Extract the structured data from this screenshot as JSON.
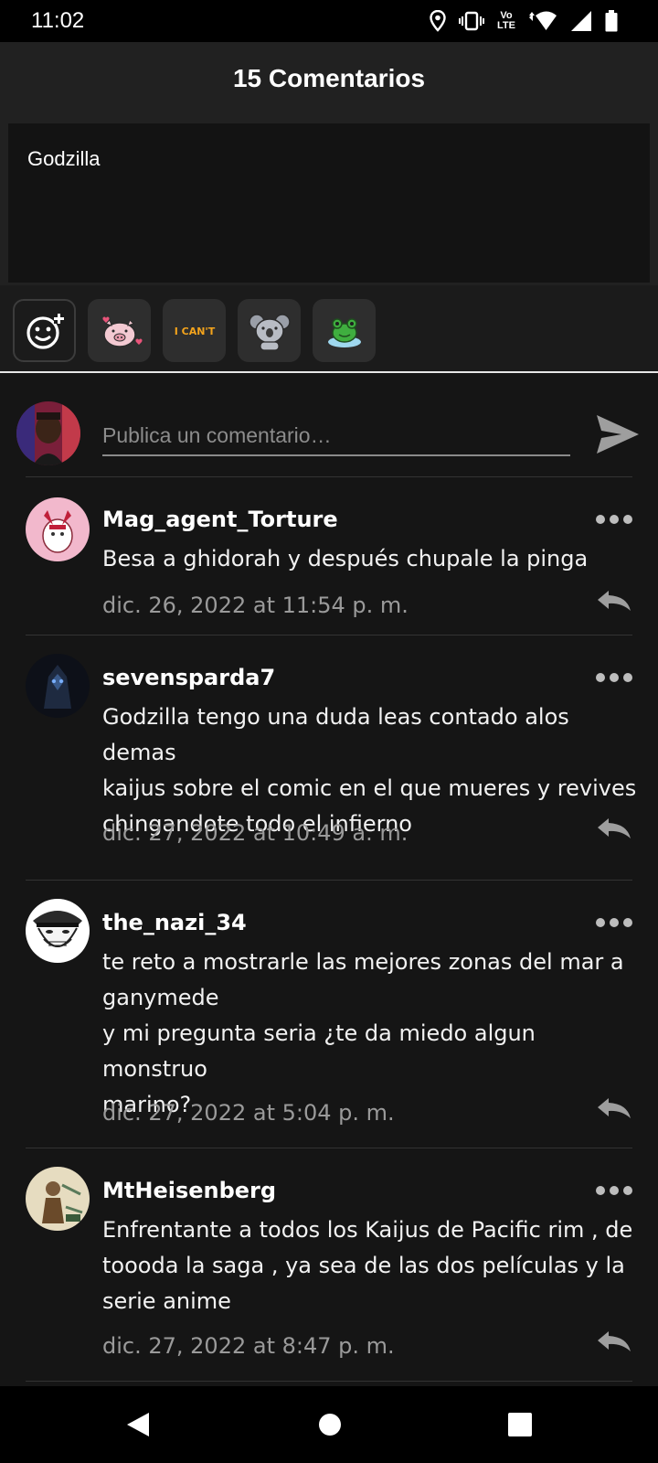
{
  "status_bar": {
    "time": "11:02",
    "volte_top": "Vo",
    "volte_bottom": "LTE",
    "icons": [
      "location-icon",
      "vibrate-icon",
      "volte-icon",
      "data-arrows-icon",
      "wifi-icon",
      "signal-icon",
      "battery-icon"
    ]
  },
  "header": {
    "title": "15 Comentarios"
  },
  "compose": {
    "text": "Godzilla"
  },
  "stickers": {
    "items": [
      "add-emoji-icon",
      "pig-sticker",
      "i-cant-sticker",
      "koala-sticker",
      "frog-sticker"
    ],
    "i_cant_label": "I CAN'T"
  },
  "post": {
    "placeholder": "Publica un comentario…",
    "send_icon": "send-icon"
  },
  "comments": [
    {
      "username": "Mag_agent_Torture",
      "text": "Besa a ghidorah y después chupale la pinga",
      "date": "dic. 26, 2022 at 11:54 p. m."
    },
    {
      "username": "sevensparda7",
      "text": "Godzilla tengo una duda leas contado alos demas\nkaijus sobre el comic en el que mueres y revives\nchingandote todo el infierno",
      "date": "dic. 27, 2022 at 10:49 a. m."
    },
    {
      "username": "the_nazi_34",
      "text": "te reto a mostrarle las mejores zonas del mar a\nganymede\ny mi pregunta seria ¿te da miedo algun monstruo\nmarino?",
      "date": "dic. 27, 2022 at 5:04 p. m."
    },
    {
      "username": "MtHeisenberg",
      "text": "Enfrentante a todos los Kaijus de Pacific rim , de\ntoooda la saga , ya sea de las dos películas y la\nserie anime",
      "date": "dic. 27, 2022 at 8:47 p. m."
    }
  ],
  "nav": {
    "icons": [
      "back-icon",
      "home-icon",
      "recents-icon"
    ]
  },
  "colors": {
    "background": "#151515",
    "header": "#212121",
    "muted": "#9a9a9a",
    "icon": "#bdbdbd"
  }
}
